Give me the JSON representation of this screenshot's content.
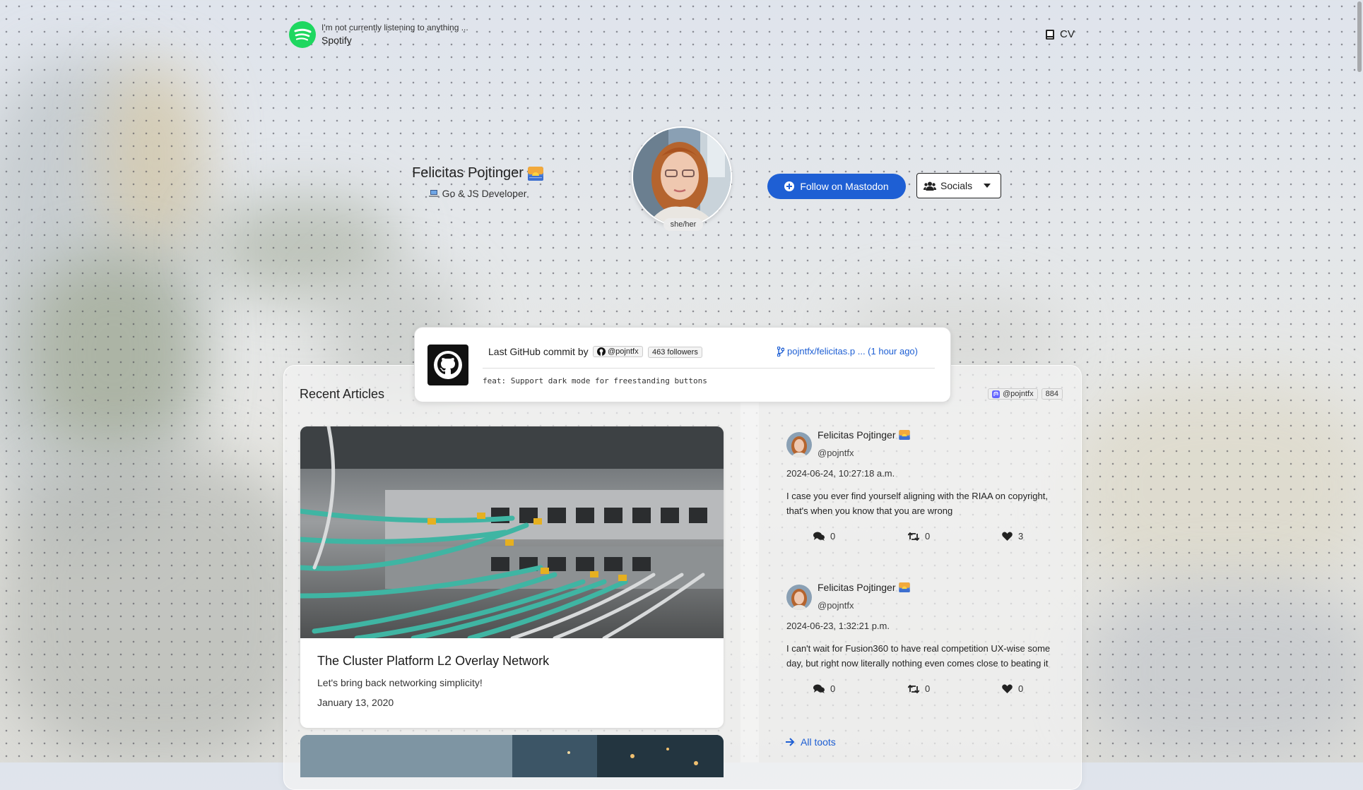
{
  "header": {
    "spotify_status": "I'm not currently listening to anything ...",
    "spotify_label": "Spotify",
    "cv_label": "CV"
  },
  "profile": {
    "name": "Felicitas Pojtinger",
    "role": "Go & JS Developer",
    "pronouns": "she/her",
    "follow_label": "Follow on Mastodon",
    "socials_label": "Socials"
  },
  "github": {
    "label": "Last GitHub commit by",
    "user": "@pojntfx",
    "followers": "463 followers",
    "repo": "pojntfx/felicitas.p ... (1 hour ago)",
    "message": "feat: Support dark mode for freestanding buttons"
  },
  "articles": {
    "title": "Recent Articles",
    "items": [
      {
        "title": "The Cluster Platform L2 Overlay Network",
        "description": "Let's bring back networking simplicity!",
        "date": "January 13, 2020"
      }
    ]
  },
  "mastodon": {
    "handle": "@pojntfx",
    "count": "884",
    "all_label": "All toots",
    "toots": [
      {
        "name": "Felicitas Pojtinger",
        "handle": "@pojntfx",
        "date": "2024-06-24, 10:27:18 a.m.",
        "text": "I case you ever find yourself aligning with the RIAA on copyright, that's when you know that you are wrong",
        "replies": "0",
        "boosts": "0",
        "likes": "3"
      },
      {
        "name": "Felicitas Pojtinger",
        "handle": "@pojntfx",
        "date": "2024-06-23, 1:32:21 p.m.",
        "text": "I can't wait for Fusion360 to have real competition UX-wise some day, but right now literally nothing even comes close to beating it",
        "replies": "0",
        "boosts": "0",
        "likes": "0"
      }
    ]
  },
  "colors": {
    "accent": "#1e5fd4",
    "spotify": "#1ed760"
  }
}
